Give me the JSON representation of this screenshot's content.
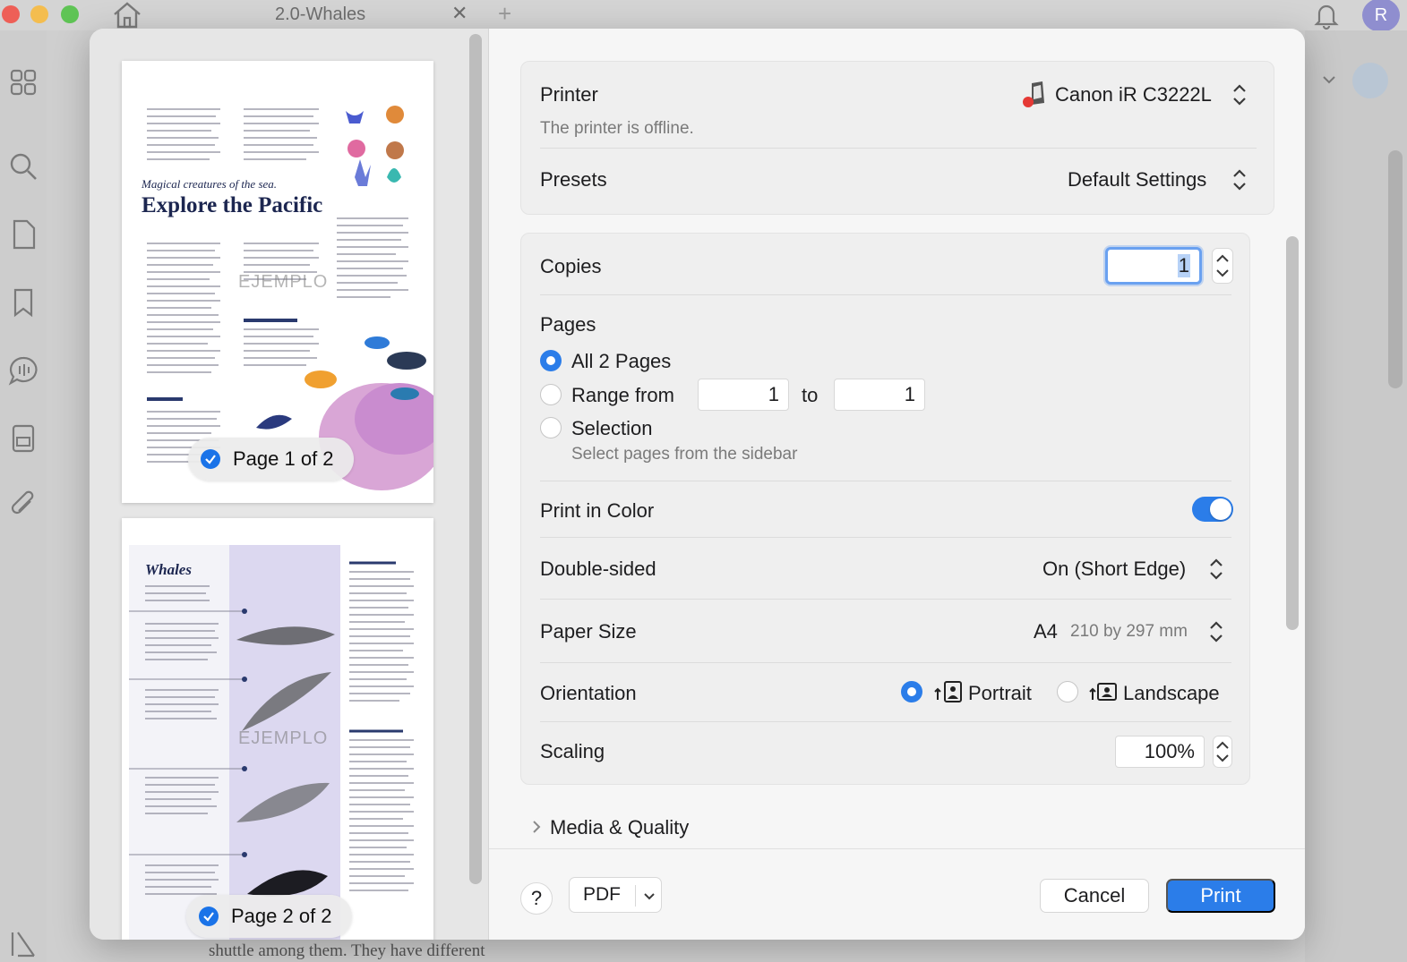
{
  "window": {
    "tab_title": "2.0-Whales",
    "tab_close_glyph": "✕",
    "tab_add_glyph": "+",
    "avatar_initial": "R",
    "sidebar_icons": [
      "grid-icon",
      "search-icon",
      "page-icon",
      "bookmark-icon",
      "comment-icon",
      "form-icon",
      "attachment-icon",
      "sidebar-toggle-icon"
    ],
    "background_doc_text": "shuttle among them. They have different"
  },
  "thumbnails": [
    {
      "subtitle": "Magical creatures of the sea.",
      "title": "Explore the Pacific",
      "watermark": "EJEMPLO",
      "badge": "Page 1 of 2",
      "selected": true
    },
    {
      "title": "Whales",
      "watermark": "EJEMPLO",
      "badge": "Page 2 of 2",
      "selected": true
    }
  ],
  "printer": {
    "label": "Printer",
    "name": "Canon iR C3222L",
    "status": "The printer is offline."
  },
  "presets": {
    "label": "Presets",
    "value": "Default Settings"
  },
  "copies": {
    "label": "Copies",
    "value": "1"
  },
  "pages": {
    "label": "Pages",
    "all_label": "All 2 Pages",
    "range_label": "Range from",
    "range_from": "1",
    "range_to_label": "to",
    "range_to": "1",
    "selection_label": "Selection",
    "selection_hint": "Select pages from the sidebar",
    "selected_option": "all"
  },
  "print_in_color": {
    "label": "Print in Color",
    "enabled": true
  },
  "double_sided": {
    "label": "Double-sided",
    "value": "On (Short Edge)"
  },
  "paper_size": {
    "label": "Paper Size",
    "value": "A4",
    "dimensions": "210 by 297 mm"
  },
  "orientation": {
    "label": "Orientation",
    "portrait_label": "Portrait",
    "landscape_label": "Landscape",
    "selected": "portrait"
  },
  "scaling": {
    "label": "Scaling",
    "value": "100%"
  },
  "media_quality": {
    "label": "Media & Quality",
    "expanded": false
  },
  "footer": {
    "help_label": "?",
    "pdf_label": "PDF",
    "cancel_label": "Cancel",
    "print_label": "Print"
  },
  "colors": {
    "accent": "#2b7de9",
    "dialog_bg": "#f6f6f6",
    "printer_status_red": "#e53935"
  }
}
